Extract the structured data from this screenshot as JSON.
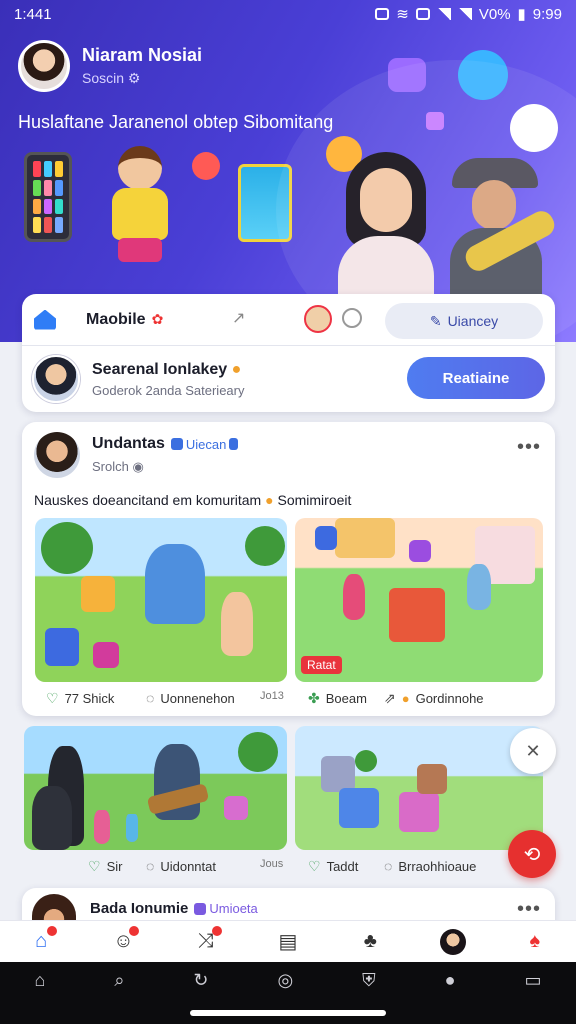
{
  "status_bar": {
    "time": "1:441",
    "battery": "V0%",
    "clock_right": "9:99"
  },
  "hero": {
    "user_name": "Niaram Nosiai",
    "user_sub": "Soscin",
    "tagline": "Huslaftane Jaranenol obtep Sibomitang"
  },
  "top_card": {
    "mini_title": "Maobile",
    "pill_label": "Uiancey",
    "suggest_name": "Searenal Ionlakey",
    "suggest_sub": "Goderok 2anda Saterieary",
    "primary_label": "Reatiaine"
  },
  "post": {
    "author": "Undantas",
    "badge": "Uiecan",
    "sub": "Srolch",
    "text": "Nauskes doeancitand em komuritam",
    "text_tail": "Somimiroeit",
    "img_tag": "Ratat",
    "likes": "77 Shick",
    "comment": "Uonnenehon",
    "meta": "Jo13",
    "share_label": "Boeam",
    "reaction": "Gordinnohe"
  },
  "post2": {
    "likes": "Sir",
    "comment": "Uidonntat",
    "meta": "Jous",
    "like2": "Taddt",
    "reaction": "Brraohhioaue"
  },
  "post3": {
    "author": "Bada Ionumie",
    "badge": "Umioeta"
  },
  "colors": {
    "brand": "#4a3fd6",
    "accent": "#2f6ff2",
    "danger": "#e6302f"
  },
  "icons": {
    "bottom_nav": [
      "home-icon",
      "profile-icon",
      "share-icon",
      "document-icon",
      "tree-icon",
      "avatar",
      "notification-icon"
    ],
    "system_nav": [
      "home-icon",
      "search-icon",
      "sync-icon",
      "compass-icon",
      "shield-icon",
      "user-icon",
      "keyboard-icon"
    ]
  }
}
